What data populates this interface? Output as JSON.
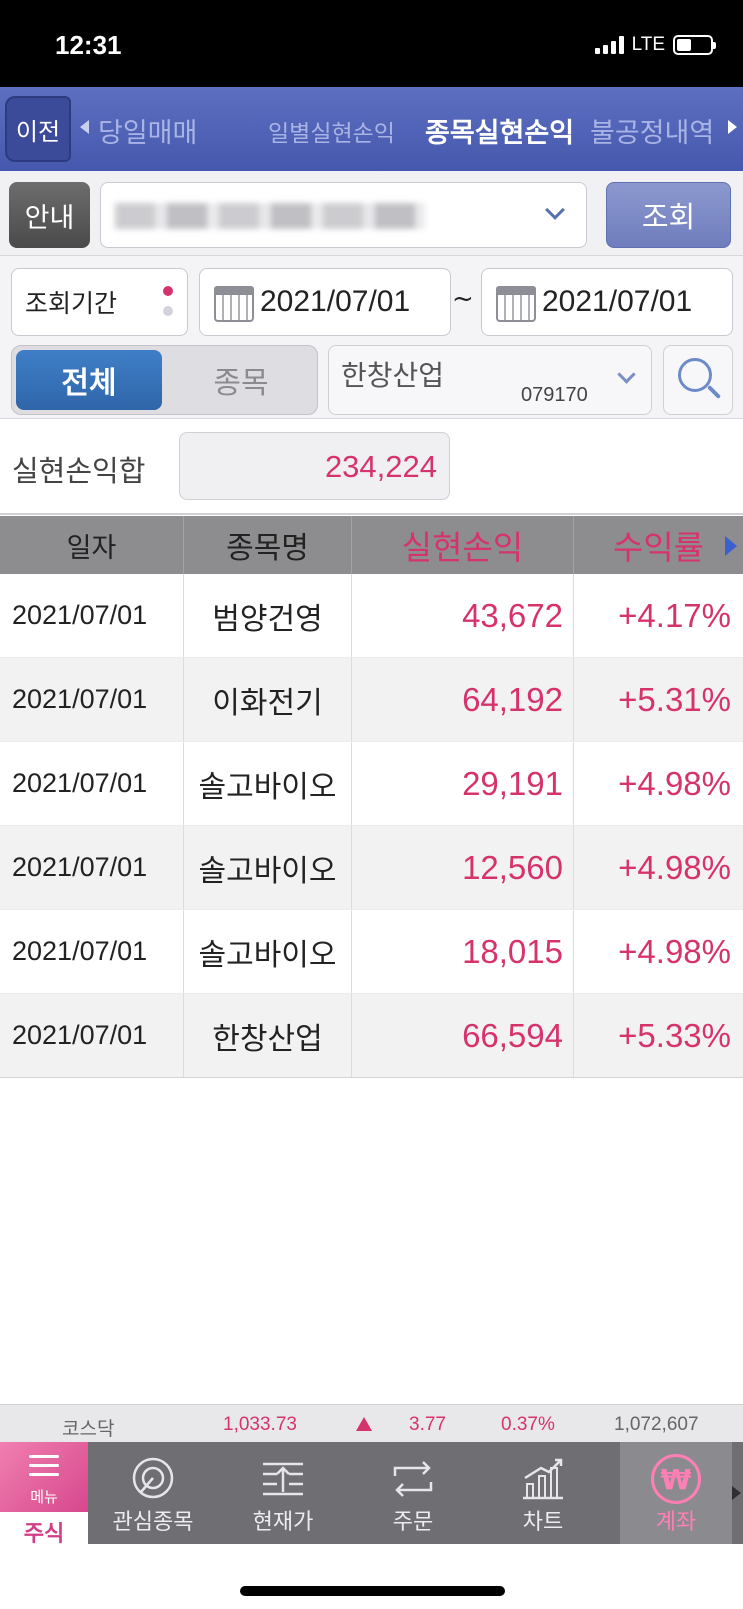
{
  "status_bar": {
    "time": "12:31",
    "network": "LTE"
  },
  "nav": {
    "back_label": "이전",
    "tabs": [
      {
        "label": "당일매매"
      },
      {
        "label": "일별실현손익"
      },
      {
        "label": "종목실현손익",
        "active": true
      },
      {
        "label": "불공정내역"
      }
    ]
  },
  "account": {
    "guide_label": "안내",
    "query_label": "조회"
  },
  "period": {
    "label": "조회기간",
    "start_date": "2021/07/01",
    "separator": "~",
    "end_date": "2021/07/01"
  },
  "filter": {
    "all_label": "전체",
    "stock_label": "종목",
    "stock_name": "한창산업",
    "stock_code": "079170"
  },
  "summary": {
    "label": "실현손익합",
    "value": "234,224"
  },
  "table": {
    "headers": [
      "일자",
      "종목명",
      "실현손익",
      "수익률"
    ],
    "rows": [
      {
        "date": "2021/07/01",
        "name": "범양건영",
        "pnl": "43,672",
        "rate": "+4.17%"
      },
      {
        "date": "2021/07/01",
        "name": "이화전기",
        "pnl": "64,192",
        "rate": "+5.31%"
      },
      {
        "date": "2021/07/01",
        "name": "솔고바이오",
        "pnl": "29,191",
        "rate": "+4.98%"
      },
      {
        "date": "2021/07/01",
        "name": "솔고바이오",
        "pnl": "12,560",
        "rate": "+4.98%"
      },
      {
        "date": "2021/07/01",
        "name": "솔고바이오",
        "pnl": "18,015",
        "rate": "+4.98%"
      },
      {
        "date": "2021/07/01",
        "name": "한창산업",
        "pnl": "66,594",
        "rate": "+5.33%"
      }
    ]
  },
  "ticker": {
    "name": "코스닥",
    "index": "1,033.73",
    "change": "3.77",
    "percent": "0.37%",
    "volume": "1,072,607"
  },
  "tabbar": {
    "menu_text": "메뉴",
    "tabs": [
      {
        "label": "주식",
        "icon": "menu-icon"
      },
      {
        "label": "관심종목",
        "icon": "watchlist-icon"
      },
      {
        "label": "현재가",
        "icon": "price-icon"
      },
      {
        "label": "주문",
        "icon": "order-icon"
      },
      {
        "label": "차트",
        "icon": "chart-icon"
      },
      {
        "label": "계좌",
        "icon": "won-icon",
        "active": true
      }
    ]
  },
  "colors": {
    "accent_pink": "#d6336c",
    "nav_blue": "#4f62b5",
    "segment_blue": "#3f7fc7"
  }
}
